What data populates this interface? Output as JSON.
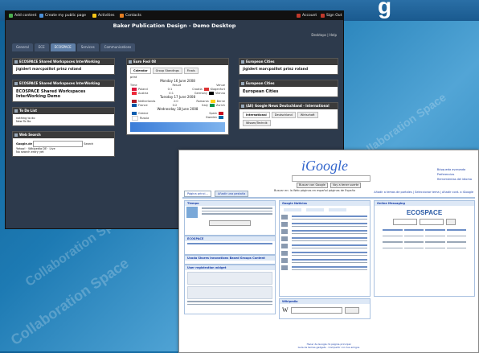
{
  "desktop": {
    "topbar": {
      "left_items": [
        "Add content",
        "Create my public page",
        "Activities",
        "Contacts"
      ],
      "right_items": [
        "Account",
        "Sign Out"
      ]
    },
    "title": "Baker Publication Design - Demo Desktop",
    "links": "Desktops | Help",
    "tabs": [
      "General",
      "ECE",
      "ECOSPACE",
      "Services",
      "Communications"
    ],
    "active_tab_index": 2,
    "widgets": {
      "shared1": {
        "title": "ECOSPACE Shared Workspaces InterWorking",
        "body": "jigidert  marcpaillot  prinz  roland"
      },
      "shared2": {
        "title": "ECOSPACE Shared Workspaces InterWorking",
        "body": "ECOSPACE Shared Workspaces InterWorking Demo"
      },
      "todo": {
        "title": "To Do List",
        "items": [
          "nothing to do",
          "New To Do"
        ]
      },
      "websearch": {
        "title": "Web Search",
        "engine": "Google.de",
        "search_btn": "Search",
        "links": [
          "Yahoo!",
          "Wikipedia DE",
          "Live"
        ],
        "result": "No search entry yet"
      },
      "euro": {
        "title": "Euro Fool 08",
        "tabs": [
          "Calendar",
          "Group Standings",
          "Finals"
        ],
        "print": "print",
        "day1": "Monday 16 June 2008",
        "day2": "Tuesday 17 June 2008",
        "day3": "Wednesday 18 June 2008",
        "cols": [
          "Time",
          "Result",
          "Venue"
        ],
        "rows1": [
          [
            "Poland",
            "0:1",
            "Croatia",
            "Klagenfurt"
          ],
          [
            "Austria",
            "0:1",
            "Germany",
            "Vienna"
          ]
        ],
        "rows2": [
          [
            "Netherlands",
            "2:0",
            "Romania",
            "Berne"
          ],
          [
            "France",
            "0:2",
            "Italy",
            "Zurich"
          ]
        ],
        "rows3": [
          [
            "Greece",
            "",
            "Spain",
            ""
          ],
          [
            "Russia",
            "",
            "Sweden",
            ""
          ]
        ]
      },
      "cities1": {
        "title": "European Cities",
        "body": "jigidert  marcpaillot  prinz  roland"
      },
      "cities2": {
        "title": "European Cities",
        "body": "European Cities"
      },
      "news": {
        "title": "(All) Google News Deutschland - International",
        "tabs": [
          "International",
          "Deutschland",
          "Wirtschaft",
          "Wissen/Technik"
        ]
      }
    }
  },
  "igoogle": {
    "logo": "iGoogle",
    "search_button": "Buscar con Google",
    "lucky_button": "Voy a tener suerte",
    "search_in": "Buscar en:  la Web  páginas en español  páginas de España",
    "top_links": [
      "Búsqueda avanzada",
      "Preferencias",
      "Herramientas del idioma"
    ],
    "tabs": [
      "Página princi...",
      "Añadir una pestaña"
    ],
    "right_links": "Añadir a temas de portales | Seleccionar tema | Añadir cont. a iGoogle",
    "gadgets": {
      "tiempo": "Tiempo",
      "ecospace": "ECOSPACE",
      "shared": "Ucoda Shares Innovations Based Groups Content",
      "users": "User registration widget",
      "noticias": "Google Noticias",
      "ecospace_mess": "Online Messaging",
      "traductor": "Wikipedia"
    },
    "messaging_logo": "ECOSPACE",
    "footer": "Hacer de Google mi página principal",
    "footer2": "Guía de temas gadgets · Compartir con tus amigos"
  },
  "watermark": "Collaboration Space"
}
